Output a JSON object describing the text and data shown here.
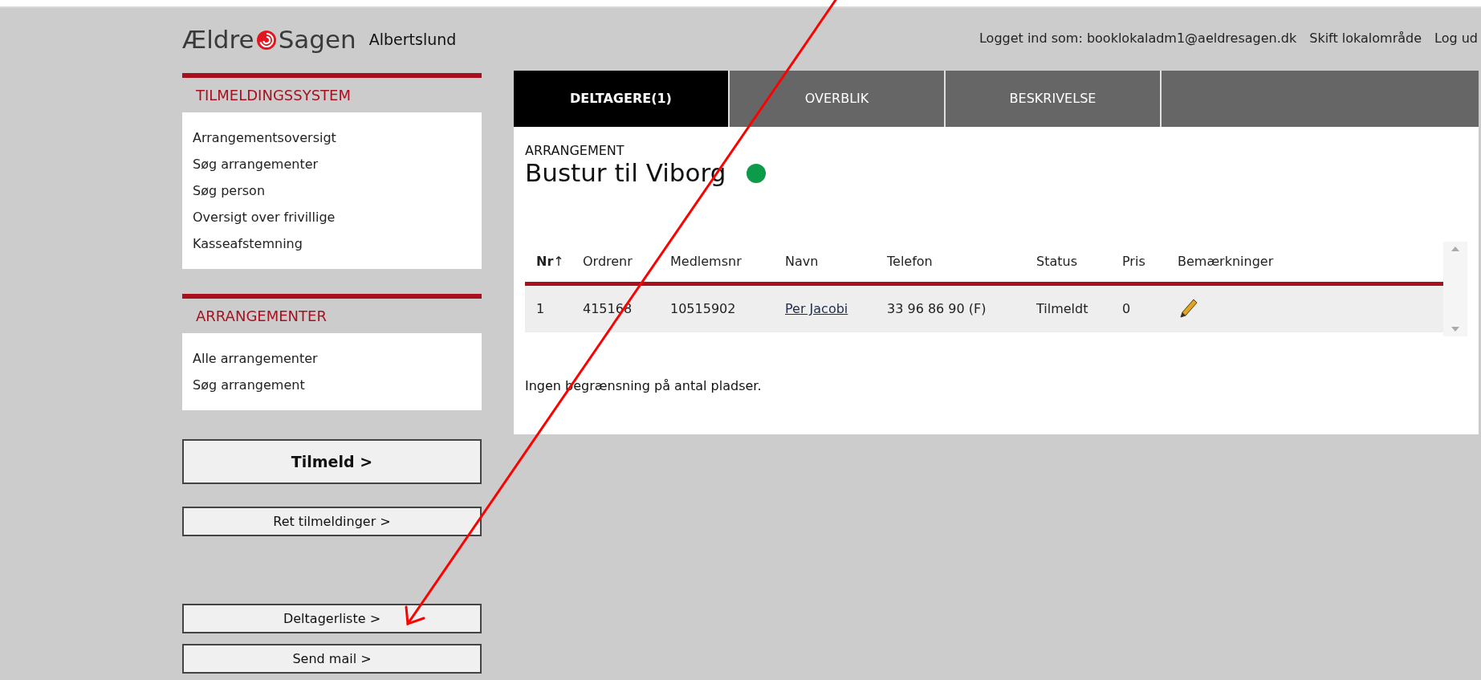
{
  "header": {
    "logo": {
      "left": "Ældre",
      "right": "Sagen"
    },
    "location": "Albertslund",
    "user_label": "Logget ind som: booklokaladm1@aeldresagen.dk",
    "links": [
      "Skift lokalområde",
      "Log ud"
    ]
  },
  "sidebar": {
    "sections": [
      {
        "title": "TILMELDINGSSYSTEM",
        "items": [
          "Arrangementsoversigt",
          "Søg arrangementer",
          "Søg person",
          "Oversigt over frivillige",
          "Kasseafstemning"
        ]
      },
      {
        "title": "ARRANGEMENTER",
        "items": [
          "Alle arrangementer",
          "Søg arrangement"
        ]
      }
    ],
    "buttons": [
      {
        "label": "Tilmeld >",
        "kind": "primary"
      },
      {
        "label": "Ret tilmeldinger >",
        "kind": "secondary"
      },
      {
        "label": "Deltagerliste >",
        "kind": "secondary"
      },
      {
        "label": "Send mail >",
        "kind": "secondary"
      }
    ]
  },
  "tabs": [
    {
      "label": "DELTAGERE(1)",
      "selected": true
    },
    {
      "label": "OVERBLIK",
      "selected": false
    },
    {
      "label": "BESKRIVELSE",
      "selected": false
    }
  ],
  "event": {
    "label": "ARRANGEMENT",
    "title": "Bustur til Viborg",
    "status_dot": {
      "color": "#0c9b48"
    }
  },
  "table": {
    "columns": [
      {
        "label": "Nr",
        "sort": "↑"
      },
      {
        "label": "Ordrenr"
      },
      {
        "label": "Medlemsnr"
      },
      {
        "label": "Navn"
      },
      {
        "label": "Telefon"
      },
      {
        "label": "Status"
      },
      {
        "label": "Pris"
      },
      {
        "label": "Bemærkninger"
      }
    ],
    "rows": [
      {
        "nr": "1",
        "ordrenr": "415168",
        "medlemsnr": "10515902",
        "navn": "Per Jacobi",
        "telefon": "33 96 86 90 (F)",
        "status": "Tilmeldt",
        "pris": "0"
      }
    ]
  },
  "note": "Ingen begrænsning på antal pladser."
}
